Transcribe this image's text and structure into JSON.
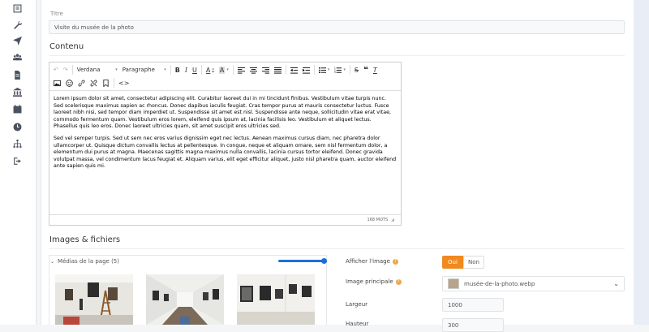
{
  "sidebar": {
    "icons": [
      "list-icon",
      "wrench-icon",
      "send-icon",
      "users-icon",
      "document-icon",
      "bank-icon",
      "calendar-icon",
      "clock-icon",
      "sitemap-icon",
      "logout-icon"
    ]
  },
  "titre": {
    "label": "Titre",
    "value": "Visite du musée de la photo"
  },
  "contenu": {
    "heading": "Contenu",
    "toolbar": {
      "font": "Verdana",
      "format": "Paragraphe"
    },
    "paragraphs": [
      "Lorem ipsum dolor sit amet, consectetur adipiscing elit. Curabitur laoreet dui in mi tincidunt finibus. Vestibulum vitae turpis nunc. Sed scelerisque maximus sapien ac rhoncus. Donec dapibus iaculis feugiat. Cras tempor purus at mauris consectetur luctus. Fusce laoreet nibh nisi, sed tempor diam imperdiet ut. Suspendisse sit amet est nisl. Suspendisse ante neque, sollicitudin vitae erat vitae, commodo fermentum quam. Vestibulum eros lorem, eleifend quis ipsum at, lacinia facilisis leo. Vestibulum et aliquet lectus. Phasellus quis leo eros. Donec laoreet ultricies quam, sit amet suscipit eros ultricies sed.",
      "Sed vel semper turpis. Sed ut sem nec eros varius dignissim eget nec lectus. Aenean maximus cursus diam, nec pharetra dolor ullamcorper ut. Quisque dictum convallis lectus at pellentesque. In congue, neque et aliquam ornare, sem nisl fermentum dolor, a elementum dui purus at magna. Maecenas sagittis magna maximus nulla convallis, lacinia cursus tortor eleifend. Donec gravida volutpat massa, vel condimentum lacus feugiat et. Aliquam varius, elit eget efficitur aliquet, justo nisl pharetra quam, auctor eleifend ante sapien quis mi."
    ],
    "word_count": "168 MOTS"
  },
  "images": {
    "heading": "Images & fichiers",
    "media_label": "Médias de la page (5)",
    "slider_value": 1.0,
    "afficher_label": "Afficher l'image",
    "oui": "Oui",
    "non": "Non",
    "image_principale_label": "Image principale",
    "image_principale_value": "musée-de-la-photo.webp",
    "largeur_label": "Largeur",
    "largeur_value": "1000",
    "hauteur_label": "Hauteur",
    "hauteur_value": "300"
  },
  "colors": {
    "accent": "#f0891f",
    "slider": "#1a6fd8"
  }
}
